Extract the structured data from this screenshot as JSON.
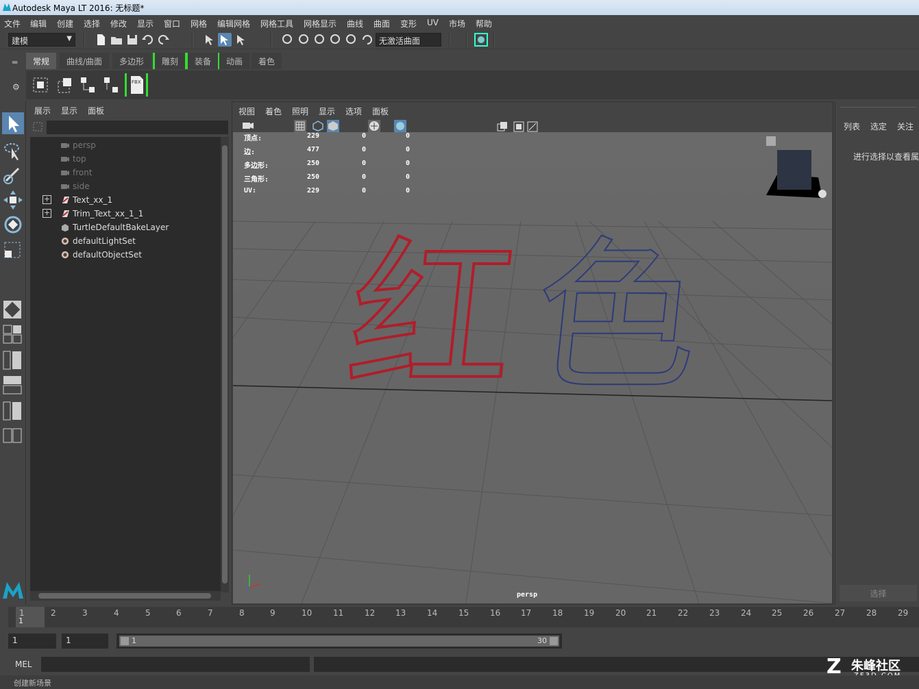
{
  "window": {
    "title": "Autodesk Maya LT 2016: 无标题*"
  },
  "menubar": [
    "文件",
    "编辑",
    "创建",
    "选择",
    "修改",
    "显示",
    "窗口",
    "网格",
    "编辑网格",
    "网格工具",
    "网格显示",
    "曲线",
    "曲面",
    "变形",
    "UV",
    "市场",
    "帮助"
  ],
  "status_line": {
    "mode": "建模",
    "live_surface": "无激活曲面"
  },
  "shelf": {
    "tabs": [
      "常规",
      "曲线/曲面",
      "多边形",
      "雕刻",
      "装备",
      "动画",
      "着色"
    ],
    "active_tab": "常规",
    "fbx_label": "FBX"
  },
  "outliner": {
    "menus": [
      "展示",
      "显示",
      "面板"
    ],
    "items": [
      {
        "label": "persp",
        "icon": "camera-icon",
        "dim": true
      },
      {
        "label": "top",
        "icon": "camera-icon",
        "dim": true
      },
      {
        "label": "front",
        "icon": "camera-icon",
        "dim": true
      },
      {
        "label": "side",
        "icon": "camera-icon",
        "dim": true
      },
      {
        "label": "Text_xx_1",
        "icon": "transform-icon",
        "expandable": true
      },
      {
        "label": "Trim_Text_xx_1_1",
        "icon": "transform-icon",
        "expandable": true
      },
      {
        "label": "TurtleDefaultBakeLayer",
        "icon": "bake-layer-icon"
      },
      {
        "label": "defaultLightSet",
        "icon": "set-icon"
      },
      {
        "label": "defaultObjectSet",
        "icon": "set-icon"
      }
    ]
  },
  "viewport": {
    "menus": [
      "视图",
      "着色",
      "照明",
      "显示",
      "选项",
      "面板"
    ],
    "hud": [
      {
        "label": "顶点:",
        "values": [
          "229",
          "0",
          "0"
        ]
      },
      {
        "label": "边:",
        "values": [
          "477",
          "0",
          "0"
        ]
      },
      {
        "label": "多边形:",
        "values": [
          "250",
          "0",
          "0"
        ]
      },
      {
        "label": "三角形:",
        "values": [
          "250",
          "0",
          "0"
        ]
      },
      {
        "label": "UV:",
        "values": [
          "229",
          "0",
          "0"
        ]
      }
    ],
    "camera_label": "persp",
    "text_red": "红",
    "text_blue": "色"
  },
  "channel_box": {
    "tabs": [
      "列表",
      "选定",
      "关注"
    ],
    "hint": "进行选择以查看属",
    "select_button": "选择"
  },
  "timeline": {
    "ticks": [
      "1",
      "2",
      "3",
      "4",
      "5",
      "6",
      "7",
      "8",
      "9",
      "10",
      "11",
      "12",
      "13",
      "14",
      "15",
      "16",
      "17",
      "18",
      "19",
      "20",
      "21",
      "22",
      "23",
      "24",
      "25",
      "26",
      "27",
      "28",
      "29"
    ],
    "current_frame": "1"
  },
  "range": {
    "start_field": "1",
    "playback_start": "1",
    "range_min": "1",
    "range_max": "30"
  },
  "command_line": {
    "label": "MEL"
  },
  "help_line": {
    "text": "创建新场景"
  },
  "watermark": {
    "name": "朱峰社区",
    "url": "ZF3D.COM"
  }
}
